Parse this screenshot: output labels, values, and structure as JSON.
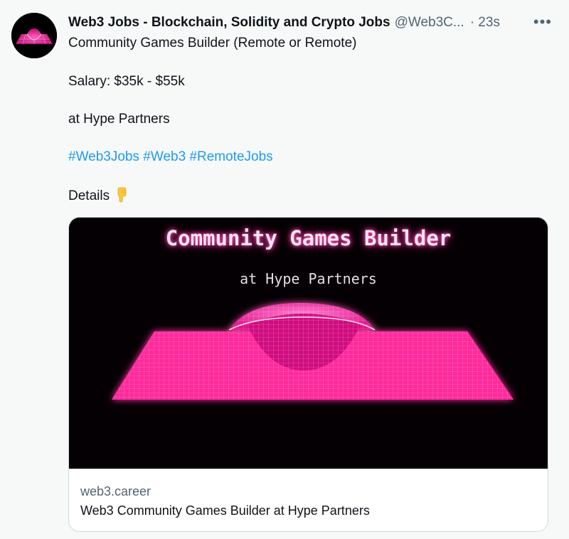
{
  "tweet": {
    "author_name": "Web3 Jobs - Blockchain, Solidity and Crypto Jobs",
    "handle": "@Web3C...",
    "time": "· 23s",
    "more_icon": "more-dots-icon",
    "lines": {
      "role": "Community Games Builder  (Remote or Remote)",
      "salary": "Salary: $35k - $55k",
      "company": "at Hype Partners",
      "details": "Details"
    },
    "hashtags": [
      "#Web3Jobs",
      "#Web3",
      "#RemoteJobs"
    ],
    "details_emoji": "pointing-down-hand-icon"
  },
  "card": {
    "image_title": "Community Games Builder",
    "image_subtitle": "at Hype Partners",
    "domain": "web3.career",
    "caption": "Web3 Community Games Builder at Hype Partners"
  },
  "colors": {
    "link": "#1d9bf0",
    "secondary_text": "#536471",
    "neon_pink": "#ff2a9c"
  }
}
